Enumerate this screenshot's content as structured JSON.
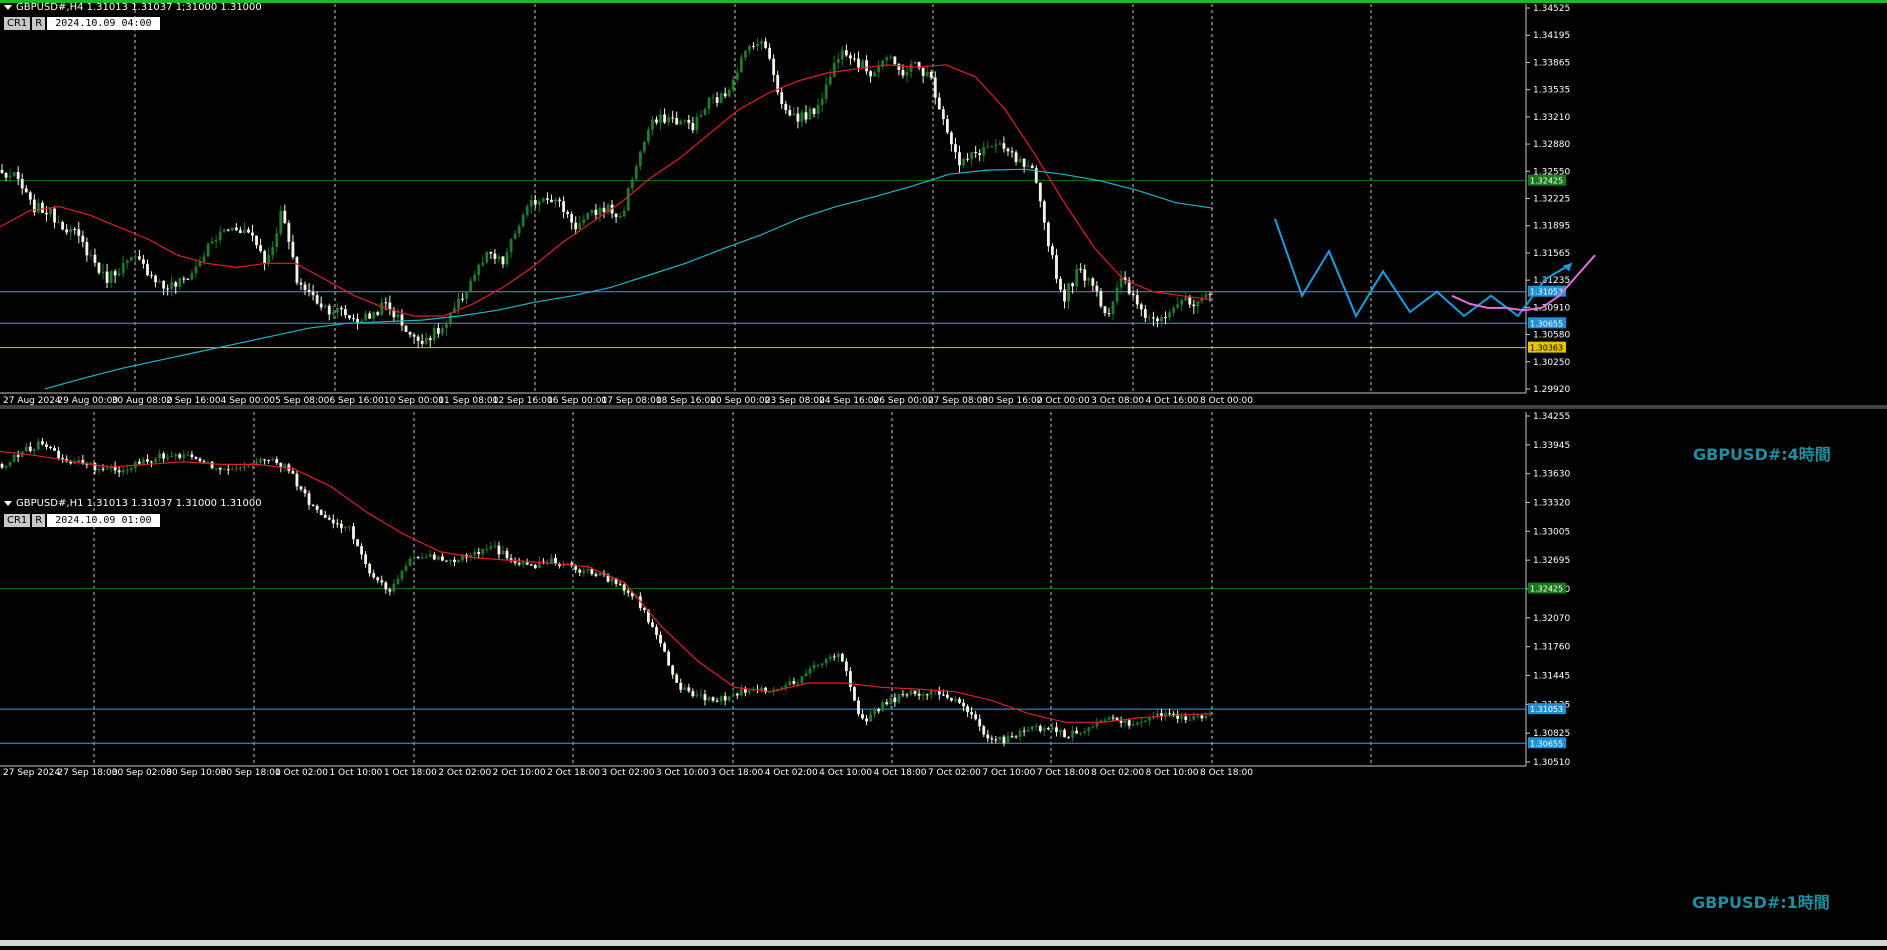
{
  "colors": {
    "bg": "#000000",
    "grid": "#c8c8c8",
    "bull": "#1f7a2e",
    "bear": "#f5f5e6",
    "ma_short": "#e02020",
    "ma_long": "#1fb7c8",
    "level_green": "#1a7a1a",
    "level_blue": "#3aa0e0",
    "level_yellow": "#e6c200",
    "drawing_blue": "#1a9ee0",
    "drawing_pink": "#e070e0",
    "axis_text": "#ffffff"
  },
  "chart_data": [
    {
      "type": "candlestick",
      "header": "GBPUSD#,H4 1.31013 1.31037 1;31000 1.31000",
      "badge": [
        "CR1",
        "R",
        "2024.10.09 04:00"
      ],
      "watermark": "GBPUSD#:4時間",
      "ylim": [
        1.298,
        1.346
      ],
      "y_ticks": [
        "1.34525",
        "1.34195",
        "1.33865",
        "1.33535",
        "1.33210",
        "1.32880",
        "1.32550",
        "1.32225",
        "1.31895",
        "1.31565",
        "1.31235",
        "1.30910",
        "1.30580",
        "1.30250",
        "1.29920"
      ],
      "x_ticks": [
        "27 Aug 2024",
        "29 Aug 00:00",
        "30 Aug 08:00",
        "2 Sep 16:00",
        "4 Sep 00:00",
        "5 Sep 08:00",
        "6 Sep 16:00",
        "10 Sep 00:00",
        "11 Sep 08:00",
        "12 Sep 16:00",
        "16 Sep 00:00",
        "17 Sep 08:00",
        "18 Sep 16:00",
        "20 Sep 00:00",
        "23 Sep 08:00",
        "24 Sep 16:00",
        "26 Sep 00:00",
        "27 Sep 08:00",
        "30 Sep 16:00",
        "2 Oct 00:00",
        "3 Oct 08:00",
        "4 Oct 16:00",
        "8 Oct 00:00"
      ],
      "levels": [
        {
          "value": 1.3242,
          "label": "1.32425",
          "color": "green"
        },
        {
          "value": 1.3105,
          "label": "1.31053",
          "color": "blue"
        },
        {
          "value": 1.3066,
          "label": "1.30655",
          "color": "blue"
        },
        {
          "value": 1.3036,
          "label": "1.30363",
          "color": "yellow"
        }
      ],
      "price_anchors": [
        1.325,
        1.3245,
        1.321,
        1.3205,
        1.319,
        1.3175,
        1.315,
        1.312,
        1.3135,
        1.3145,
        1.313,
        1.311,
        1.3115,
        1.313,
        1.316,
        1.318,
        1.3185,
        1.3175,
        1.314,
        1.3205,
        1.312,
        1.31,
        1.3085,
        1.308,
        1.307,
        1.3075,
        1.309,
        1.307,
        1.3045,
        1.305,
        1.306,
        1.309,
        1.3125,
        1.315,
        1.314,
        1.3185,
        1.3215,
        1.3225,
        1.321,
        1.3185,
        1.32,
        1.321,
        1.3195,
        1.326,
        1.331,
        1.332,
        1.3315,
        1.331,
        1.334,
        1.3345,
        1.3385,
        1.3415,
        1.3405,
        1.333,
        1.332,
        1.3325,
        1.336,
        1.341,
        1.339,
        1.3375,
        1.3395,
        1.3375,
        1.3385,
        1.337,
        1.3315,
        1.326,
        1.3275,
        1.3285,
        1.328,
        1.3265,
        1.325,
        1.317,
        1.3095,
        1.313,
        1.312,
        1.3075,
        1.312,
        1.309,
        1.307,
        1.308,
        1.3095,
        1.3085,
        1.31
      ],
      "ma_short": [
        1.3185,
        1.3205,
        1.321,
        1.32,
        1.3185,
        1.317,
        1.315,
        1.314,
        1.3135,
        1.314,
        1.314,
        1.312,
        1.31,
        1.3085,
        1.3075,
        1.3075,
        1.309,
        1.311,
        1.3135,
        1.3165,
        1.319,
        1.3215,
        1.3245,
        1.327,
        1.33,
        1.333,
        1.335,
        1.3365,
        1.3375,
        1.338,
        1.3385,
        1.3382,
        1.3385,
        1.337,
        1.333,
        1.3275,
        1.3215,
        1.316,
        1.312,
        1.3105,
        1.31,
        1.3095
      ],
      "ma_long": [
        1.2985,
        1.2998,
        1.301,
        1.302,
        1.303,
        1.304,
        1.305,
        1.306,
        1.3066,
        1.3068,
        1.307,
        1.3075,
        1.3082,
        1.3092,
        1.31,
        1.311,
        1.3125,
        1.314,
        1.3158,
        1.3175,
        1.3195,
        1.321,
        1.3222,
        1.3235,
        1.325,
        1.3255,
        1.3256,
        1.325,
        1.3242,
        1.323,
        1.3215,
        1.3208
      ],
      "drawing_blue": [
        [
          1.3195,
          0
        ],
        [
          1.31,
          1
        ],
        [
          1.3155,
          2
        ],
        [
          1.3075,
          3
        ],
        [
          1.313,
          4
        ],
        [
          1.308,
          5
        ],
        [
          1.3105,
          6
        ],
        [
          1.3075,
          7
        ],
        [
          1.31,
          8
        ],
        [
          1.3075,
          9
        ],
        [
          1.312,
          10
        ],
        [
          1.314,
          11
        ]
      ],
      "drawing_pink": [
        1.31,
        1.309,
        1.3085,
        1.3085,
        1.3082,
        1.3085,
        1.31,
        1.3125,
        1.315
      ]
    },
    {
      "type": "candlestick",
      "header": "GBPUSD#,H1 1.31013 1.31037 1.31000 1.31000",
      "badge": [
        "CR1",
        "R",
        "2024.10.09 01:00"
      ],
      "watermark": "GBPUSD#:1時間",
      "ylim": [
        1.304,
        1.3445
      ],
      "y_ticks": [
        "1.34255",
        "1.33945",
        "1.33630",
        "1.33320",
        "1.33005",
        "1.32695",
        "1.32380",
        "1.32070",
        "1.31760",
        "1.31445",
        "1.31135",
        "1.30825",
        "1.30510"
      ],
      "x_ticks": [
        "27 Sep 2024",
        "27 Sep 18:00",
        "30 Sep 02:00",
        "30 Sep 10:00",
        "30 Sep 18:00",
        "1 Oct 02:00",
        "1 Oct 10:00",
        "1 Oct 18:00",
        "2 Oct 02:00",
        "2 Oct 10:00",
        "2 Oct 18:00",
        "3 Oct 02:00",
        "3 Oct 10:00",
        "3 Oct 18:00",
        "4 Oct 02:00",
        "4 Oct 10:00",
        "4 Oct 18:00",
        "7 Oct 02:00",
        "7 Oct 10:00",
        "7 Oct 18:00",
        "8 Oct 02:00",
        "8 Oct 10:00",
        "8 Oct 18:00"
      ],
      "levels": [
        {
          "value": 1.3243,
          "label": "1.32425",
          "color": "green"
        },
        {
          "value": 1.3105,
          "label": "1.31053",
          "color": "blue"
        },
        {
          "value": 1.3066,
          "label": "1.30655",
          "color": "blue"
        }
      ],
      "price_anchors": [
        1.338,
        1.34,
        1.341,
        1.339,
        1.3385,
        1.338,
        1.338,
        1.339,
        1.3395,
        1.3395,
        1.3385,
        1.338,
        1.3385,
        1.339,
        1.338,
        1.334,
        1.332,
        1.331,
        1.326,
        1.324,
        1.328,
        1.328,
        1.3275,
        1.3285,
        1.329,
        1.3275,
        1.327,
        1.3275,
        1.3265,
        1.326,
        1.325,
        1.323,
        1.319,
        1.313,
        1.312,
        1.3115,
        1.3125,
        1.3125,
        1.313,
        1.314,
        1.316,
        1.3165,
        1.309,
        1.311,
        1.312,
        1.3125,
        1.312,
        1.311,
        1.3075,
        1.307,
        1.308,
        1.3085,
        1.3075,
        1.3085,
        1.3095,
        1.309,
        1.3095,
        1.31,
        1.3095,
        1.31
      ],
      "ma_short": [
        1.34,
        1.3395,
        1.3388,
        1.3382,
        1.3385,
        1.3388,
        1.3385,
        1.3385,
        1.338,
        1.336,
        1.333,
        1.3305,
        1.3285,
        1.3278,
        1.3275,
        1.3272,
        1.3268,
        1.325,
        1.32,
        1.316,
        1.313,
        1.3125,
        1.3135,
        1.3135,
        1.313,
        1.3128,
        1.3125,
        1.3115,
        1.31,
        1.309,
        1.309,
        1.3095,
        1.3098,
        1.31
      ]
    }
  ]
}
